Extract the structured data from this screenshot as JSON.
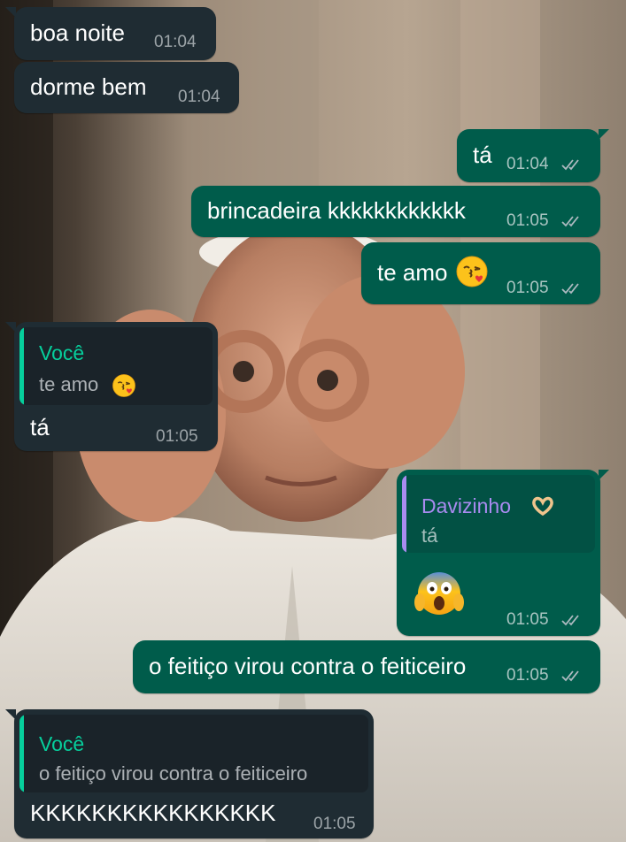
{
  "colors": {
    "incoming_bubble": "#1f2c33",
    "outgoing_bubble": "#005c4b",
    "quote_accent_in": "#06cf9c",
    "quote_accent_out": "#a98bf0",
    "read_ticks": "#aebac1"
  },
  "messages": [
    {
      "direction": "in",
      "text": "boa noite",
      "time": "01:04"
    },
    {
      "direction": "in",
      "text": "dorme bem",
      "time": "01:04"
    },
    {
      "direction": "out",
      "text": "tá",
      "time": "01:04",
      "status": "delivered-double-check"
    },
    {
      "direction": "out",
      "text": "brincadeira kkkkkkkkkkkk",
      "time": "01:05",
      "status": "delivered-double-check"
    },
    {
      "direction": "out",
      "text": "te amo",
      "emoji": "kissing-heart-face",
      "time": "01:05",
      "status": "delivered-double-check"
    },
    {
      "direction": "in",
      "reply": {
        "author": "Você",
        "text": "te amo",
        "emoji": "kissing-heart-face"
      },
      "text": "tá",
      "time": "01:05"
    },
    {
      "direction": "out",
      "reply": {
        "author": "Davizinho",
        "author_emoji": "heart-hands",
        "text": "tá"
      },
      "emoji": "screaming-face",
      "time": "01:05",
      "status": "delivered-double-check"
    },
    {
      "direction": "out",
      "text": "o feitiço virou contra o feiticeiro",
      "time": "01:05",
      "status": "delivered-double-check"
    },
    {
      "direction": "in",
      "reply": {
        "author": "Você",
        "text": "o feitiço virou contra o feiticeiro"
      },
      "text": "KKKKKKKKKKKKKKKK",
      "time": "01:05"
    }
  ]
}
